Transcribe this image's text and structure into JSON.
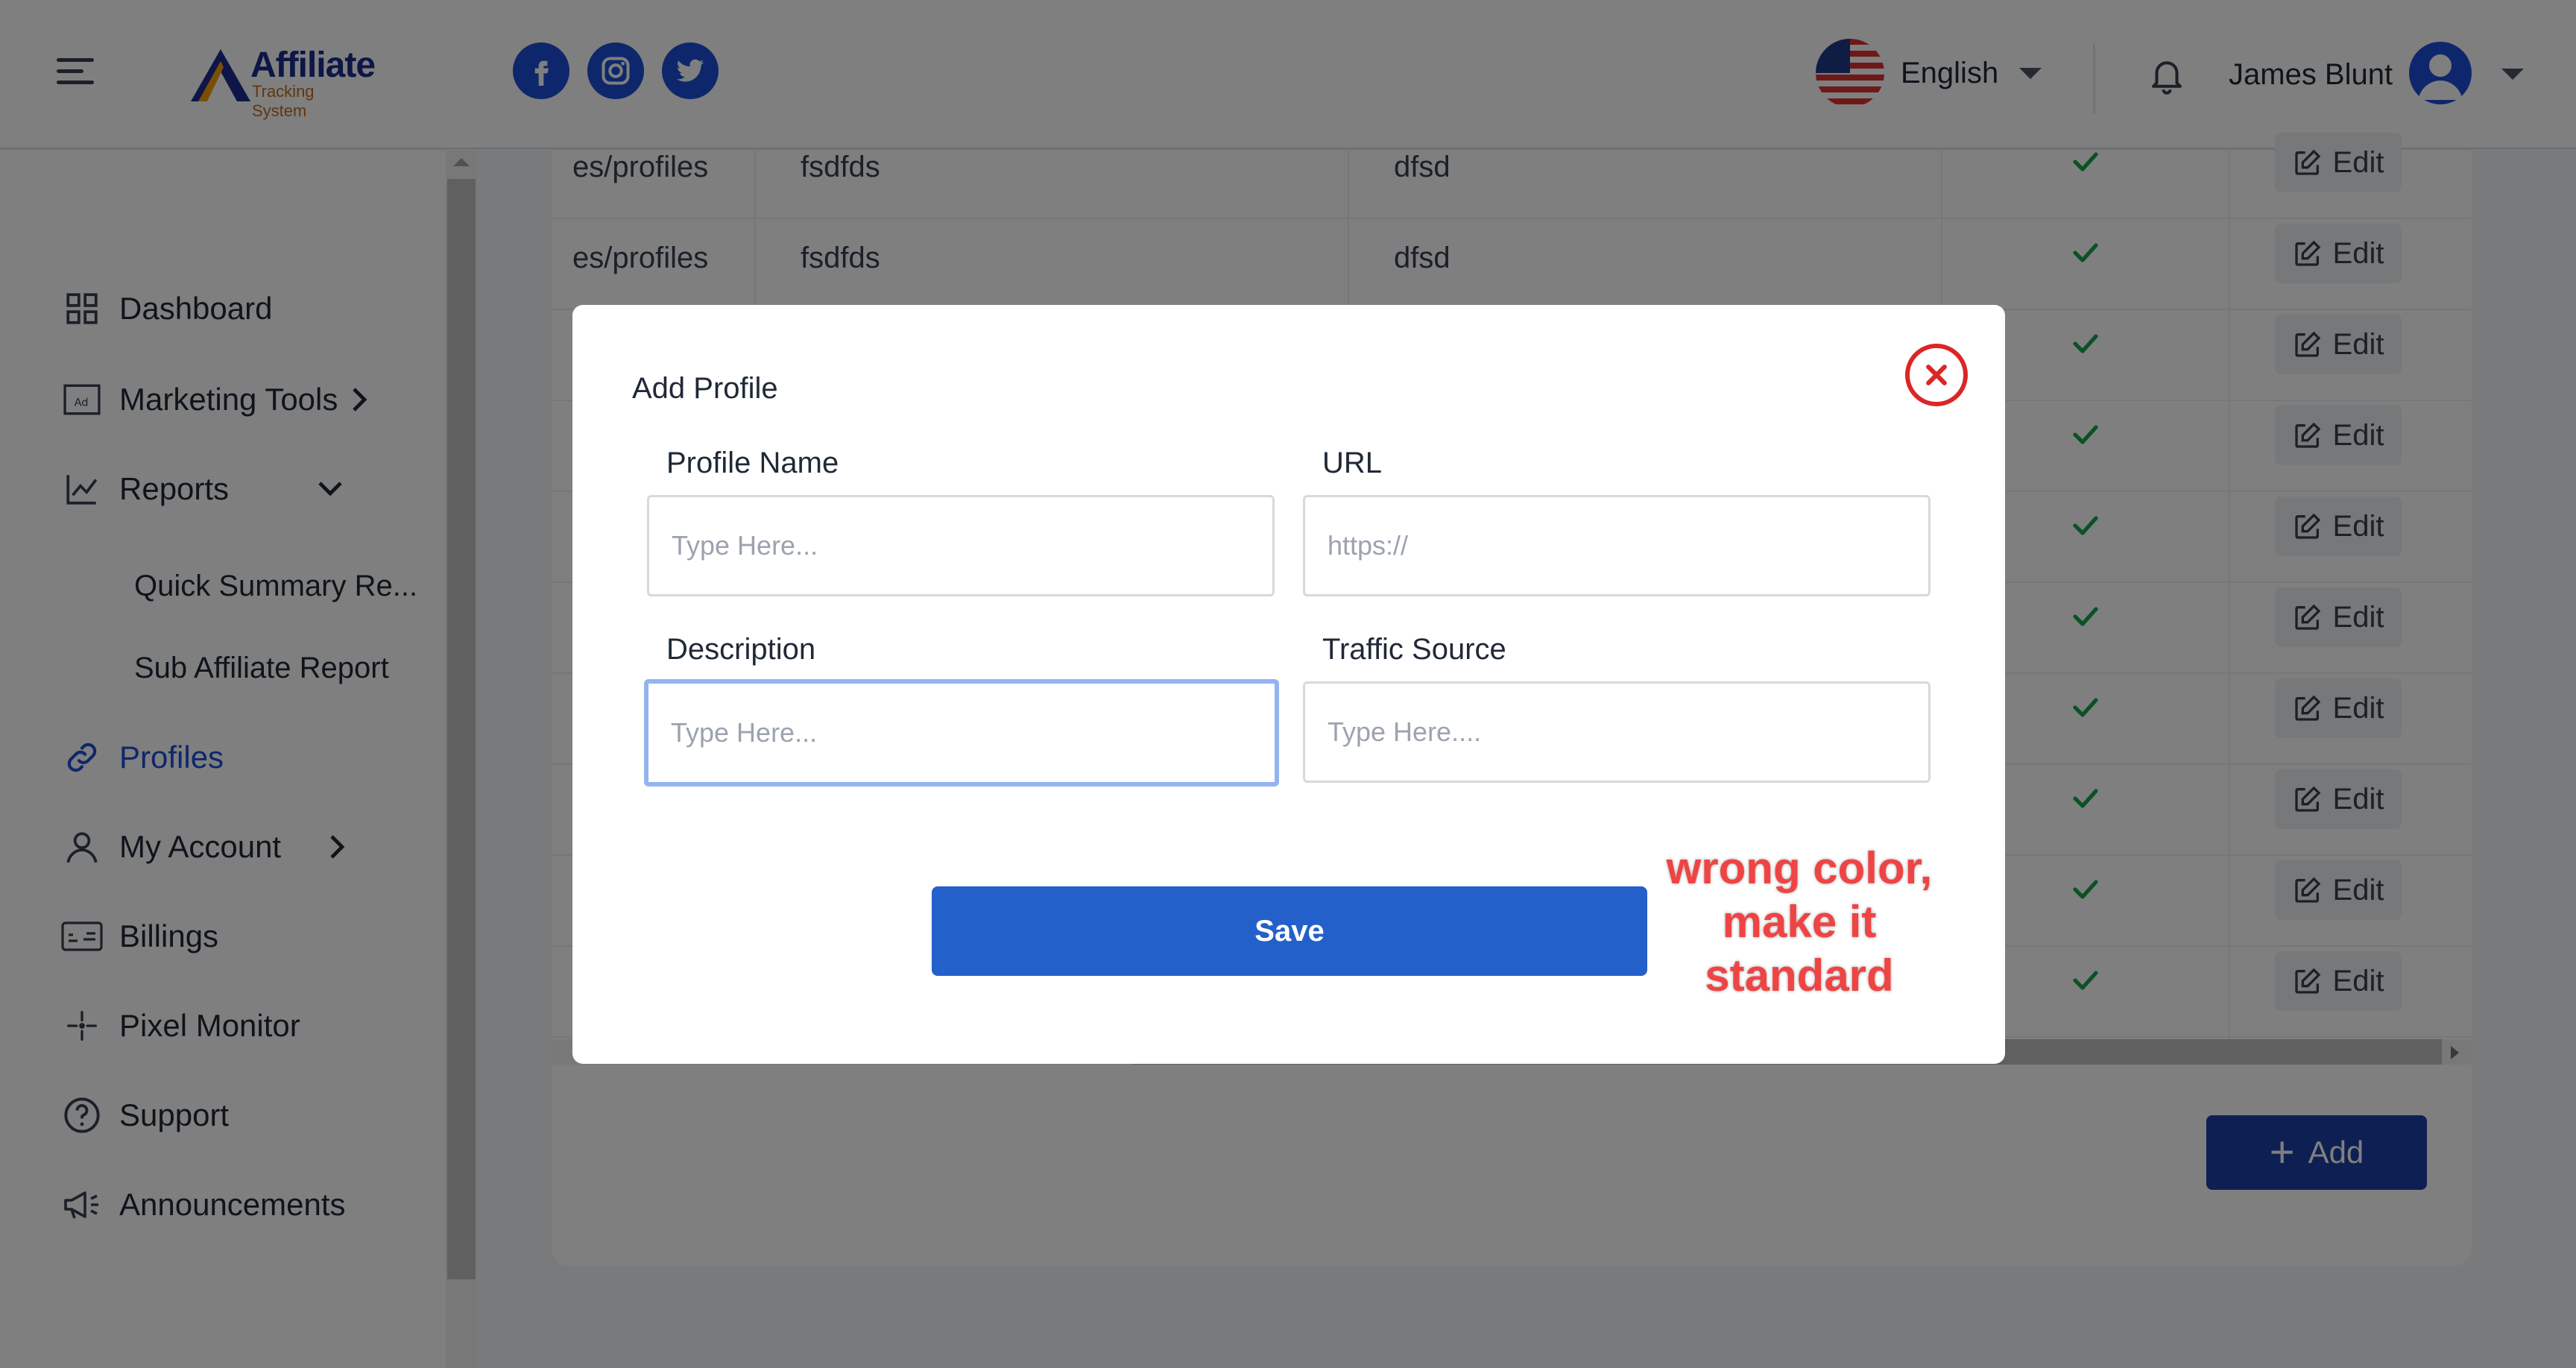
{
  "header": {
    "logo_word": "Affiliate",
    "logo_sub": "Tracking System",
    "social": [
      "facebook-icon",
      "instagram-icon",
      "twitter-icon"
    ],
    "language": "English",
    "user_name": "James Blunt"
  },
  "sidebar": {
    "items": [
      {
        "label": "Dashboard",
        "icon": "dashboard-icon"
      },
      {
        "label": "Marketing Tools",
        "icon": "ad-icon"
      },
      {
        "label": "Reports",
        "icon": "chart-icon"
      },
      {
        "label": "Quick Summary Re..."
      },
      {
        "label": "Sub Affiliate Report"
      },
      {
        "label": "Profiles",
        "icon": "link-icon",
        "active": true
      },
      {
        "label": "My Account",
        "icon": "user-icon"
      },
      {
        "label": "Billings",
        "icon": "billing-icon"
      },
      {
        "label": "Pixel Monitor",
        "icon": "sparkle-icon"
      },
      {
        "label": "Support",
        "icon": "help-icon"
      },
      {
        "label": "Announcements",
        "icon": "megaphone-icon"
      }
    ]
  },
  "table": {
    "rows": [
      {
        "url": "es/profiles",
        "name": "fsdfds",
        "desc": "dfsd",
        "edit": "Edit"
      },
      {
        "url": "es/profiles",
        "name": "fsdfds",
        "desc": "dfsd",
        "edit": "Edit"
      },
      {
        "edit": "Edit"
      },
      {
        "edit": "Edit"
      },
      {
        "edit": "Edit"
      },
      {
        "edit": "Edit"
      },
      {
        "edit": "Edit"
      },
      {
        "edit": "Edit"
      },
      {
        "edit": "Edit"
      },
      {
        "edit": "Edit"
      }
    ],
    "add_label": "Add"
  },
  "modal": {
    "title": "Add Profile",
    "profile_name": {
      "label": "Profile Name",
      "placeholder": "Type Here..."
    },
    "url": {
      "label": "URL",
      "placeholder": "https://"
    },
    "description": {
      "label": "Description",
      "placeholder": "Type Here..."
    },
    "traffic_source": {
      "label": "Traffic Source",
      "placeholder": "Type Here...."
    },
    "save_label": "Save"
  },
  "annotation": {
    "text": "wrong color, make it standard",
    "color": "#ef4444"
  },
  "colors": {
    "primary": "#1d4ed8",
    "save_button": "#2460c9",
    "close": "#dc2626"
  }
}
